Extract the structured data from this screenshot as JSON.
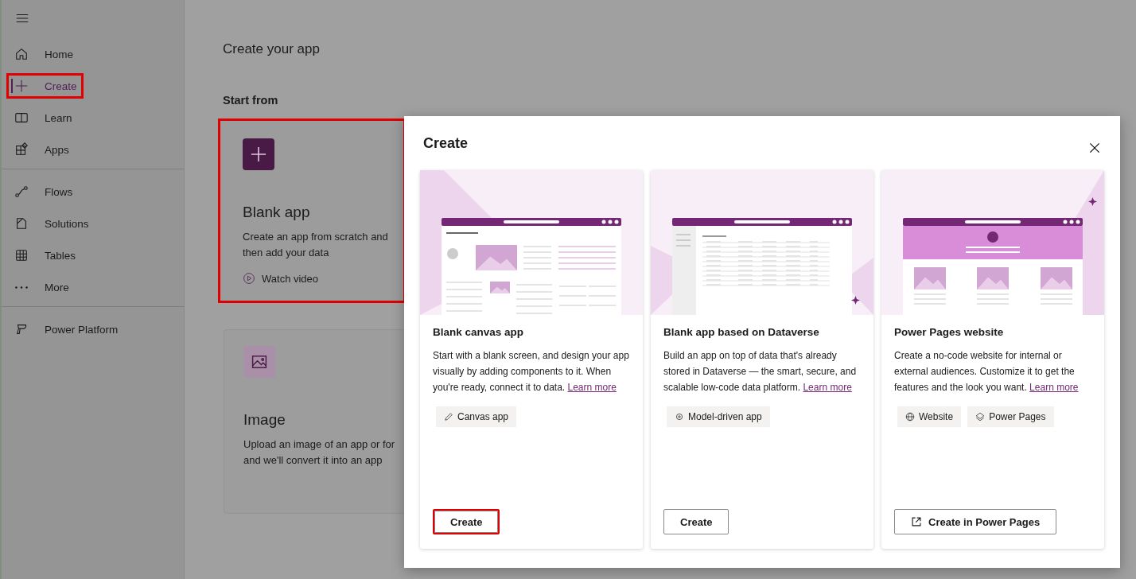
{
  "sidebar": {
    "groups": [
      {
        "items": [
          {
            "label": "Home",
            "selected": false,
            "highlighted": false
          },
          {
            "label": "Create",
            "selected": true,
            "highlighted": true
          },
          {
            "label": "Learn",
            "selected": false,
            "highlighted": false
          },
          {
            "label": "Apps",
            "selected": false,
            "highlighted": false
          }
        ]
      },
      {
        "items": [
          {
            "label": "Flows",
            "selected": false,
            "highlighted": false
          },
          {
            "label": "Solutions",
            "selected": false,
            "highlighted": false
          },
          {
            "label": "Tables",
            "selected": false,
            "highlighted": false
          },
          {
            "label": "More",
            "selected": false,
            "highlighted": false
          }
        ]
      },
      {
        "items": [
          {
            "label": "Power Platform",
            "selected": false,
            "highlighted": false
          }
        ]
      }
    ]
  },
  "main": {
    "title": "Create your app",
    "section": "Start from",
    "cards": [
      {
        "kind": "blank",
        "title": "Blank app",
        "description": "Create an app from scratch and then add your data",
        "link": "Watch video",
        "highlighted": true
      },
      {
        "kind": "image",
        "title": "Image",
        "description": "Upload an image of an app or for\nand we'll convert it into an app",
        "highlighted": false
      }
    ]
  },
  "dialog": {
    "title": "Create",
    "options": [
      {
        "kind": "canvas",
        "title": "Blank canvas app",
        "description": "Start with a blank screen, and design your app visually by adding components to it. When you're ready, connect it to data.",
        "link": "Learn more",
        "tags": [
          "Canvas app"
        ],
        "button": "Create",
        "highlighted": true
      },
      {
        "kind": "dataverse",
        "title": "Blank app based on Dataverse",
        "description": "Build an app on top of data that's already stored in Dataverse — the smart, secure, and scalable low-code data platform.",
        "link": "Learn more",
        "tags": [
          "Model-driven app"
        ],
        "button": "Create",
        "highlighted": false
      },
      {
        "kind": "pages",
        "title": "Power Pages website",
        "description": "Create a no-code website for internal or external audiences. Customize it to get the features and the look you want.",
        "link": "Learn more",
        "tags": [
          "Website",
          "Power Pages"
        ],
        "button": "Create in Power Pages",
        "highlighted": false
      }
    ]
  }
}
